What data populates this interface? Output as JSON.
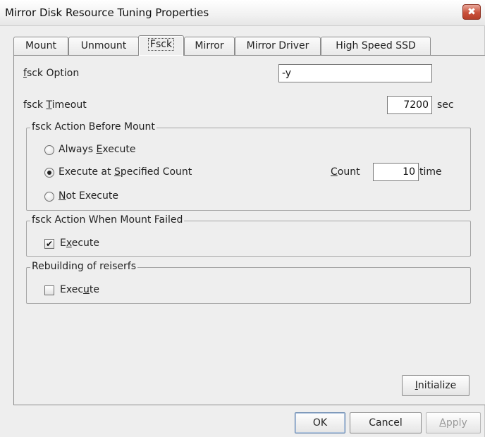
{
  "window": {
    "title": "Mirror Disk Resource Tuning Properties",
    "close_glyph": "✖"
  },
  "tabs": [
    {
      "label": "Mount",
      "active": false
    },
    {
      "label": "Unmount",
      "active": false
    },
    {
      "label": "Fsck",
      "active": true
    },
    {
      "label": "Mirror",
      "active": false
    },
    {
      "label": "Mirror Driver",
      "active": false
    },
    {
      "label": "High Speed SSD",
      "active": false
    }
  ],
  "fsck": {
    "option": {
      "label_mnemonic": "f",
      "label_rest": "sck Option",
      "value": "-y"
    },
    "timeout": {
      "label_pre": "fsck ",
      "label_mnemonic": "T",
      "label_rest": "imeout",
      "value": "7200",
      "unit": "sec"
    },
    "before_mount": {
      "title": "fsck Action Before Mount",
      "always": {
        "pre": "Always ",
        "mnemonic": "E",
        "rest": "xecute",
        "checked": false
      },
      "specified": {
        "pre": "Execute at ",
        "mnemonic": "S",
        "rest": "pecified Count",
        "checked": true
      },
      "not_execute": {
        "pre": "",
        "mnemonic": "N",
        "rest": "ot Execute",
        "checked": false
      },
      "count": {
        "mnemonic": "C",
        "rest": "ount",
        "value": "10",
        "unit": "time"
      }
    },
    "when_failed": {
      "title": "fsck Action When Mount Failed",
      "execute": {
        "pre": "E",
        "mnemonic": "x",
        "rest": "ecute",
        "checked": true
      }
    },
    "reiserfs": {
      "title": "Rebuilding of reiserfs",
      "execute": {
        "pre": "Exec",
        "mnemonic": "u",
        "rest": "te",
        "checked": false
      }
    }
  },
  "buttons": {
    "initialize": {
      "mnemonic": "I",
      "rest": "nitialize"
    },
    "ok": "OK",
    "cancel": "Cancel",
    "apply": {
      "mnemonic": "A",
      "rest": "pply"
    }
  },
  "check_glyph": "✔"
}
